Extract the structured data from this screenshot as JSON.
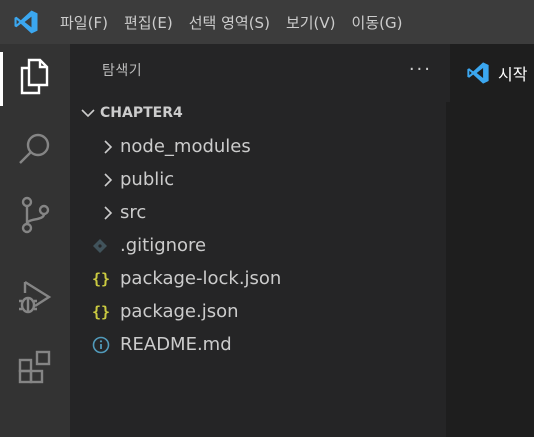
{
  "menubar": {
    "logo_icon": "vscode-logo-icon",
    "items": [
      {
        "label": "파일(F)"
      },
      {
        "label": "편집(E)"
      },
      {
        "label": "선택 영역(S)"
      },
      {
        "label": "보기(V)"
      },
      {
        "label": "이동(G)"
      }
    ]
  },
  "activitybar": {
    "items": [
      {
        "icon": "files-icon",
        "active": true
      },
      {
        "icon": "search-icon"
      },
      {
        "icon": "source-control-icon"
      },
      {
        "icon": "run-debug-icon"
      },
      {
        "icon": "extensions-icon"
      }
    ]
  },
  "sidebar": {
    "title": "탐색기",
    "more_actions": "···",
    "section": {
      "label": "CHAPTER4",
      "expanded": true
    },
    "folders": [
      {
        "label": "node_modules"
      },
      {
        "label": "public"
      },
      {
        "label": "src"
      }
    ],
    "files": [
      {
        "label": ".gitignore",
        "icon": "git-diamond-icon",
        "icon_glyph": "◆",
        "color": "#41535b"
      },
      {
        "label": "package-lock.json",
        "icon": "json-braces-icon",
        "icon_glyph": "{}",
        "color": "#cbcb41"
      },
      {
        "label": "package.json",
        "icon": "json-braces-icon",
        "icon_glyph": "{}",
        "color": "#cbcb41"
      },
      {
        "label": "README.md",
        "icon": "info-circle-icon",
        "icon_glyph": "ⓘ",
        "color": "#519aba"
      }
    ]
  },
  "editor": {
    "tab": {
      "label": "시작",
      "icon": "vscode-logo-icon"
    }
  },
  "colors": {
    "menubar_bg": "#3c3c3c",
    "activitybar_bg": "#333333",
    "sidebar_bg": "#252526",
    "editor_bg": "#1e1e1e",
    "accent_blue": "#3ba7f0"
  }
}
